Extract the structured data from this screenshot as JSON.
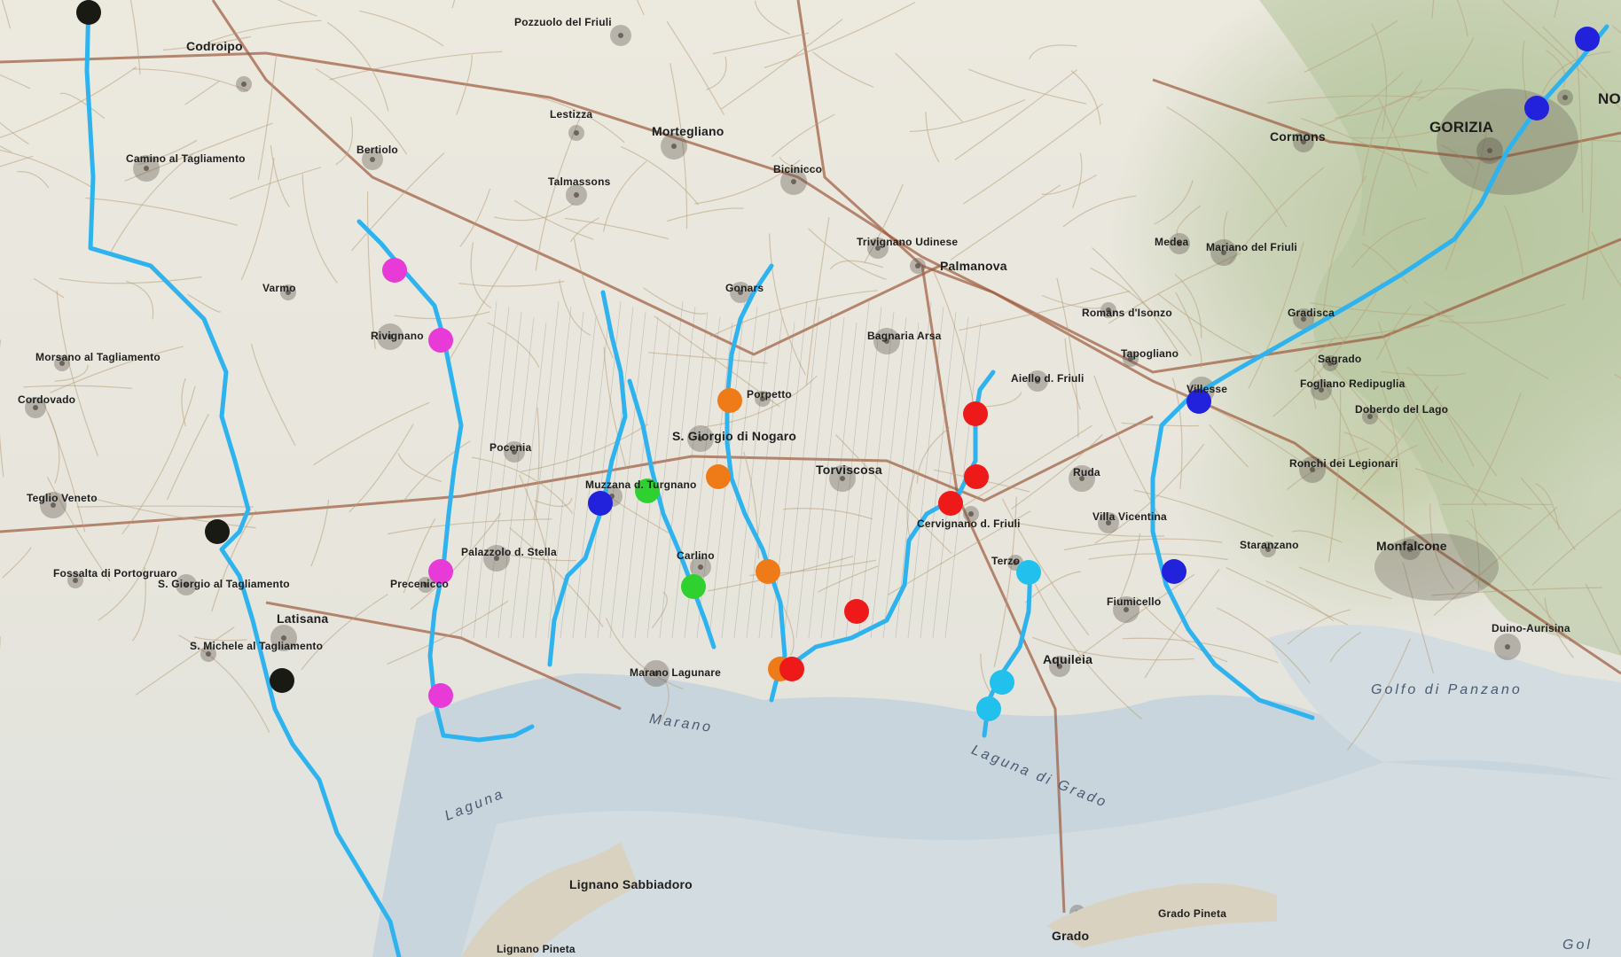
{
  "map": {
    "colors": {
      "river": "#2fb3ee",
      "land": "#e8e6dd",
      "lagoon": "#c9d5dc",
      "sea": "#d3dce0",
      "hills": "#b5c49c",
      "road_major": "#9c5a3c",
      "road_minor": "#b8a07c",
      "settlement": "#5a5048"
    },
    "marker_groups": [
      {
        "id": "tagliamento",
        "color": "#1a1a14"
      },
      {
        "id": "stella",
        "color": "#e83ad6"
      },
      {
        "id": "turgnano",
        "color": "#2222dd"
      },
      {
        "id": "zellina",
        "color": "#2fd12f"
      },
      {
        "id": "corno",
        "color": "#ee7a18"
      },
      {
        "id": "ausa",
        "color": "#ee1a1a"
      },
      {
        "id": "natissa",
        "color": "#22c0ec"
      },
      {
        "id": "isonzo",
        "color": "#2222dd"
      }
    ],
    "labels": {
      "codroipo": "Codroipo",
      "pozzuolo": "Pozzuolo del Friuli",
      "mortegliano": "Mortegliano",
      "lestizza": "Lestizza",
      "talmassons": "Talmassons",
      "bicinicco": "Bicinicco",
      "palmanova": "Palmanova",
      "gonars": "Gonars",
      "rivignano": "Rivignano",
      "varmo": "Varmo",
      "bertiolo": "Bertiolo",
      "camino": "Camino al Tagliamento",
      "morsano": "Morsano al Tagliamento",
      "cordovado": "Cordovado",
      "teglio": "Teglio Veneto",
      "fossalta": "Fossalta di Portogruaro",
      "sgiorgio_rich": "S. Giorgio al Tagliamento",
      "latisana": "Latisana",
      "smichele": "S. Michele al Tagliamento",
      "pocenia": "Pocenia",
      "palazzolo": "Palazzolo d. Stella",
      "precenicco": "Precenicco",
      "muzzana": "Muzzana d. Turgnano",
      "sgiorgio_nogaro": "S. Giorgio di Nogaro",
      "porpetto": "Porpetto",
      "carlino": "Carlino",
      "torviscosa": "Torviscosa",
      "cervignano": "Cervignano d. Friuli",
      "aiello": "Aiello d. Friuli",
      "ruda": "Ruda",
      "terzo": "Terzo",
      "aquileia": "Aquileia",
      "fiumicello": "Fiumicello",
      "grado": "Grado",
      "grado_pineta": "Grado Pineta",
      "marano": "Marano Lagunare",
      "lignano": "Lignano Sabbiadoro",
      "lignano_pineta": "Lignano Pineta",
      "cormons": "Cormons",
      "gorizia": "GORIZIA",
      "nova": "NOV",
      "gradisca": "Gradisca",
      "mariano": "Mariano del Friuli",
      "romans": "Romans d'Isonzo",
      "medea": "Medea",
      "villesse": "Villesse",
      "sagrado": "Sagrado",
      "fogliano": "Fogliano Redipuglia",
      "ronchi": "Ronchi dei Legionari",
      "staranzano": "Staranzano",
      "monfalcone": "Monfalcone",
      "duino": "Duino-Aurisina",
      "doberdo": "Doberdo del Lago",
      "laguna_a": "Laguna",
      "laguna_b": "Marano",
      "laguna_grado": "Laguna di Grado",
      "golfo": "Golfo di Panzano",
      "golfo_edge": "Gol",
      "trivignano": "Trivignano Udinese",
      "bagnaria": "Bagnaria Arsa",
      "tapogliano": "Tapogliano",
      "villa_vicentina": "Villa Vicentina",
      "cervignano_short": "Cervignano"
    }
  }
}
